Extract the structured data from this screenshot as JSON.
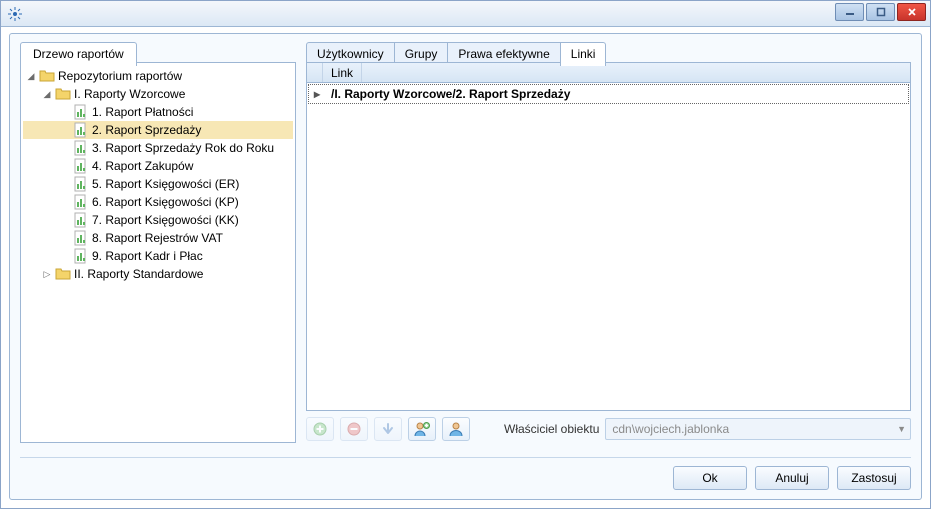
{
  "left_tab": "Drzewo raportów",
  "tree": {
    "root": {
      "label": "Repozytorium raportów",
      "children": [
        {
          "label": "I. Raporty Wzorcowe",
          "expanded": true,
          "children": [
            {
              "label": "1. Raport Płatności"
            },
            {
              "label": "2. Raport Sprzedaży",
              "selected": true
            },
            {
              "label": "3. Raport Sprzedaży Rok do Roku"
            },
            {
              "label": "4. Raport Zakupów"
            },
            {
              "label": "5. Raport Księgowości (ER)"
            },
            {
              "label": "6. Raport Księgowości (KP)"
            },
            {
              "label": "7. Raport Księgowości (KK)"
            },
            {
              "label": "8. Raport Rejestrów VAT"
            },
            {
              "label": "9. Raport Kadr i Płac"
            }
          ]
        },
        {
          "label": "II. Raporty Standardowe",
          "expanded": false
        }
      ]
    }
  },
  "right_tabs": {
    "items": [
      {
        "label": "Użytkownicy"
      },
      {
        "label": "Grupy"
      },
      {
        "label": "Prawa efektywne"
      },
      {
        "label": "Linki",
        "active": true
      }
    ]
  },
  "grid": {
    "header": "Link",
    "rows": [
      {
        "text": "/I. Raporty Wzorcowe/2. Raport Sprzedaży"
      }
    ]
  },
  "owner": {
    "label": "Właściciel obiektu",
    "value": "cdn\\wojciech.jablonka"
  },
  "buttons": {
    "ok": "Ok",
    "cancel": "Anuluj",
    "apply": "Zastosuj"
  },
  "action_icons": {
    "add": "add-icon",
    "remove": "remove-icon",
    "down": "arrow-down-icon",
    "user_add": "user-add-icon",
    "user": "user-icon"
  }
}
